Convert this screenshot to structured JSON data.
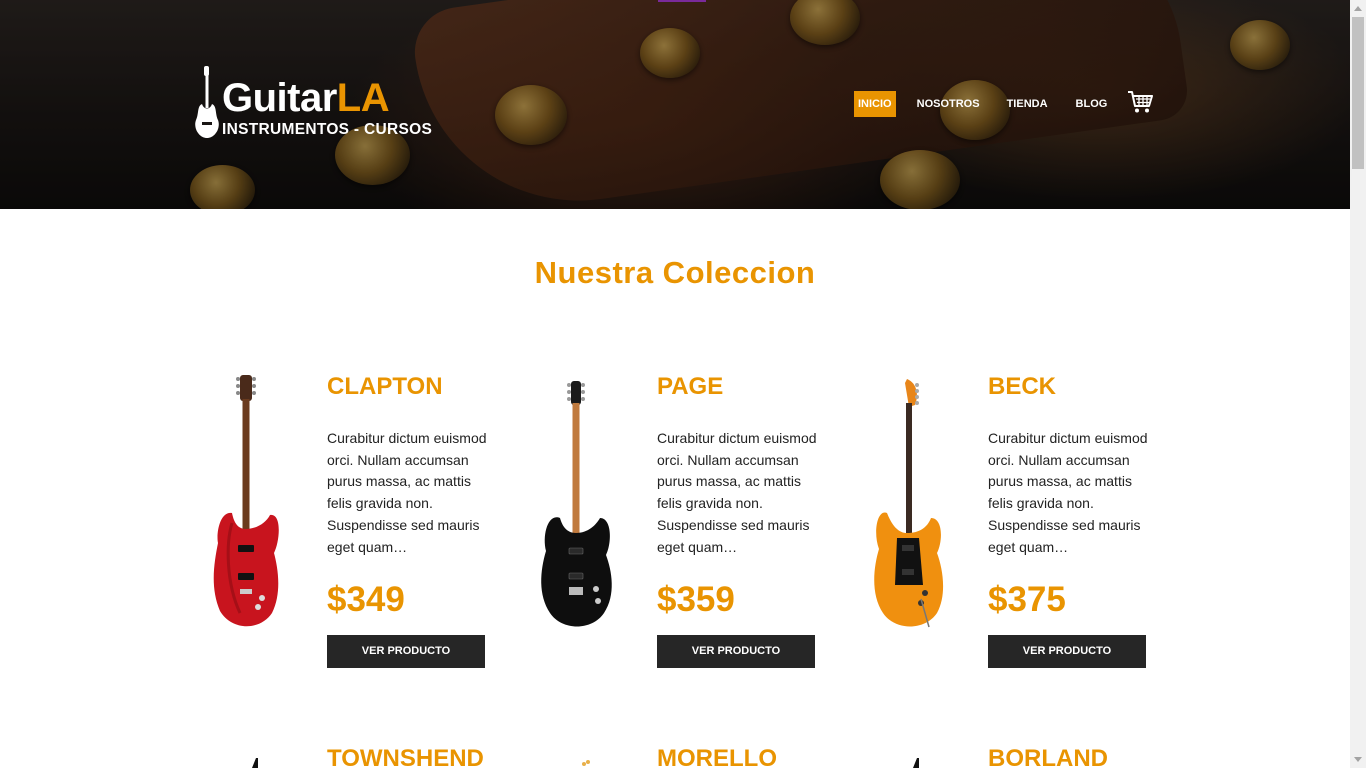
{
  "colors": {
    "accent": "#e99401",
    "dark_button": "#262626",
    "text": "#222222"
  },
  "logo": {
    "title_main": "Guitar",
    "title_accent": "LA",
    "subtitle": "INSTRUMENTOS - CURSOS"
  },
  "nav": {
    "items": [
      {
        "label": "INICIO",
        "active": true
      },
      {
        "label": "NOSOTROS",
        "active": false
      },
      {
        "label": "TIENDA",
        "active": false
      },
      {
        "label": "BLOG",
        "active": false
      }
    ],
    "cart_icon": "shopping-cart-icon"
  },
  "main": {
    "title": "Nuestra Coleccion",
    "products": [
      {
        "name": "CLAPTON",
        "description": "Curabitur dictum euismod orci. Nullam accumsan purus massa, ac mattis felis gravida non. Suspendisse sed mauris eget quam…",
        "price": "$349",
        "button": "VER PRODUCTO",
        "guitar_color": "#c8141e"
      },
      {
        "name": "PAGE",
        "description": "Curabitur dictum euismod orci. Nullam accumsan purus massa, ac mattis felis gravida non. Suspendisse sed mauris eget quam…",
        "price": "$359",
        "button": "VER PRODUCTO",
        "guitar_color": "#111111"
      },
      {
        "name": "BECK",
        "description": "Curabitur dictum euismod orci. Nullam accumsan purus massa, ac mattis felis gravida non. Suspendisse sed mauris eget quam…",
        "price": "$375",
        "button": "VER PRODUCTO",
        "guitar_color": "#f0900f"
      }
    ],
    "next_row": [
      {
        "name": "TOWNSHEND"
      },
      {
        "name": "MORELLO"
      },
      {
        "name": "BORLAND"
      }
    ]
  }
}
